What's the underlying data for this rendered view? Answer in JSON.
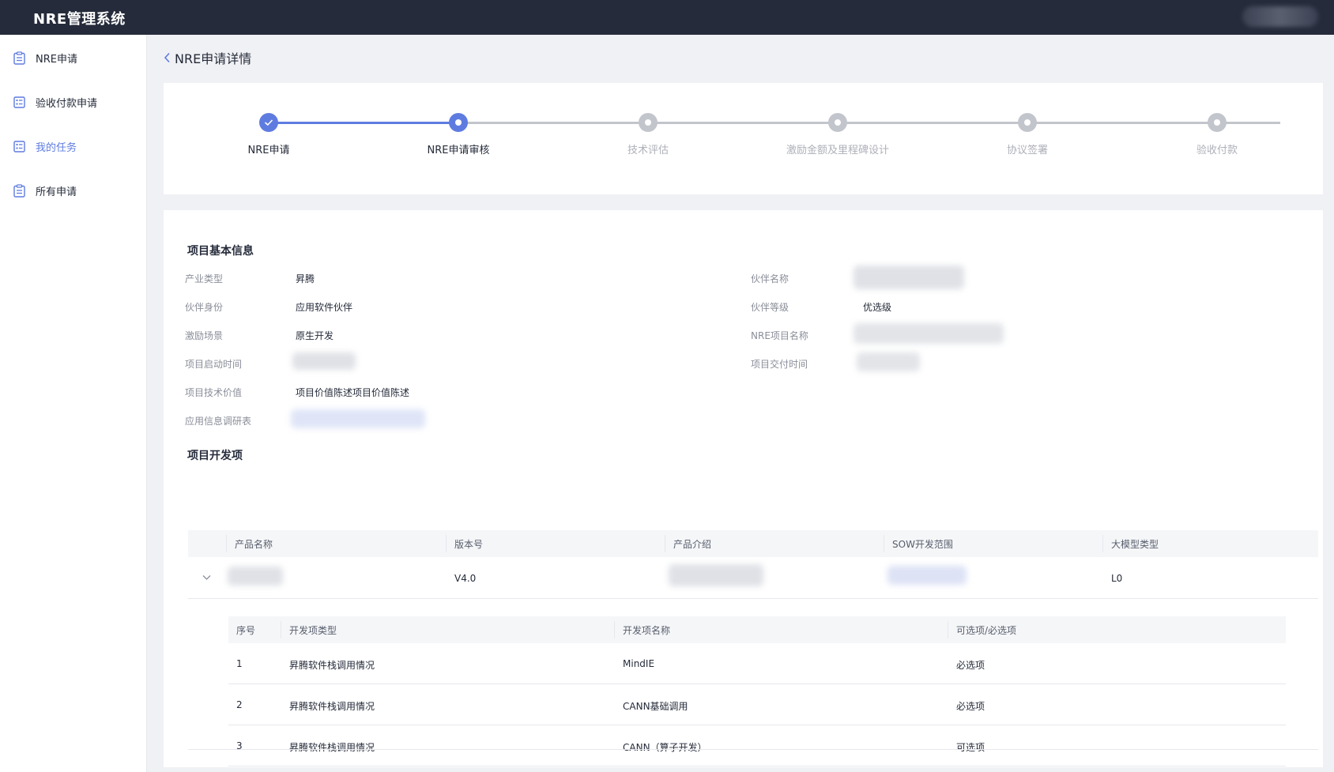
{
  "app": {
    "title": "NRE管理系统"
  },
  "sidebar": {
    "items": [
      {
        "label": "NRE申请",
        "icon": "clipboard-icon",
        "active": false
      },
      {
        "label": "验收付款申请",
        "icon": "checklist-icon",
        "active": false
      },
      {
        "label": "我的任务",
        "icon": "task-list-icon",
        "active": true
      },
      {
        "label": "所有申请",
        "icon": "clipboard-icon",
        "active": false
      }
    ]
  },
  "page": {
    "back_title": "NRE申请详情"
  },
  "steps": [
    {
      "label": "NRE申请",
      "status": "done"
    },
    {
      "label": "NRE申请审核",
      "status": "current"
    },
    {
      "label": "技术评估",
      "status": "pending"
    },
    {
      "label": "激励金额及里程碑设计",
      "status": "pending"
    },
    {
      "label": "协议签署",
      "status": "pending"
    },
    {
      "label": "验收付款",
      "status": "pending"
    }
  ],
  "basic_info": {
    "title": "项目基本信息",
    "left": [
      {
        "label": "产业类型",
        "value": "昇腾"
      },
      {
        "label": "伙伴身份",
        "value": "应用软件伙伴"
      },
      {
        "label": "激励场景",
        "value": "原生开发"
      },
      {
        "label": "项目启动时间",
        "value": ""
      },
      {
        "label": "项目技术价值",
        "value": "项目价值陈述项目价值陈述"
      },
      {
        "label": "应用信息调研表",
        "value": ""
      }
    ],
    "right": [
      {
        "label": "伙伴名称",
        "value": ""
      },
      {
        "label": "伙伴等级",
        "value": "优选级"
      },
      {
        "label": "NRE项目名称",
        "value": ""
      },
      {
        "label": "项目交付时间",
        "value": ""
      }
    ]
  },
  "dev_items": {
    "title": "项目开发项",
    "columns": [
      "产品名称",
      "版本号",
      "产品介绍",
      "SOW开发范围",
      "大模型类型"
    ],
    "row": {
      "product_name": "",
      "version": "V4.0",
      "intro": "",
      "sow": "",
      "model_type": "L0"
    },
    "sub_columns": [
      "序号",
      "开发项类型",
      "开发项名称",
      "可选项/必选项"
    ],
    "sub_rows": [
      {
        "no": "1",
        "type": "昇腾软件栈调用情况",
        "name": "MindIE",
        "req": "必选项"
      },
      {
        "no": "2",
        "type": "昇腾软件栈调用情况",
        "name": "CANN基础调用",
        "req": "必选项"
      },
      {
        "no": "3",
        "type": "昇腾软件栈调用情况",
        "name": "CANN（算子开发）",
        "req": "可选项"
      }
    ]
  },
  "colors": {
    "accent": "#5e7ce0",
    "topbar": "#252b3a",
    "pending": "#c2c5cc",
    "label": "#8a8e99"
  }
}
